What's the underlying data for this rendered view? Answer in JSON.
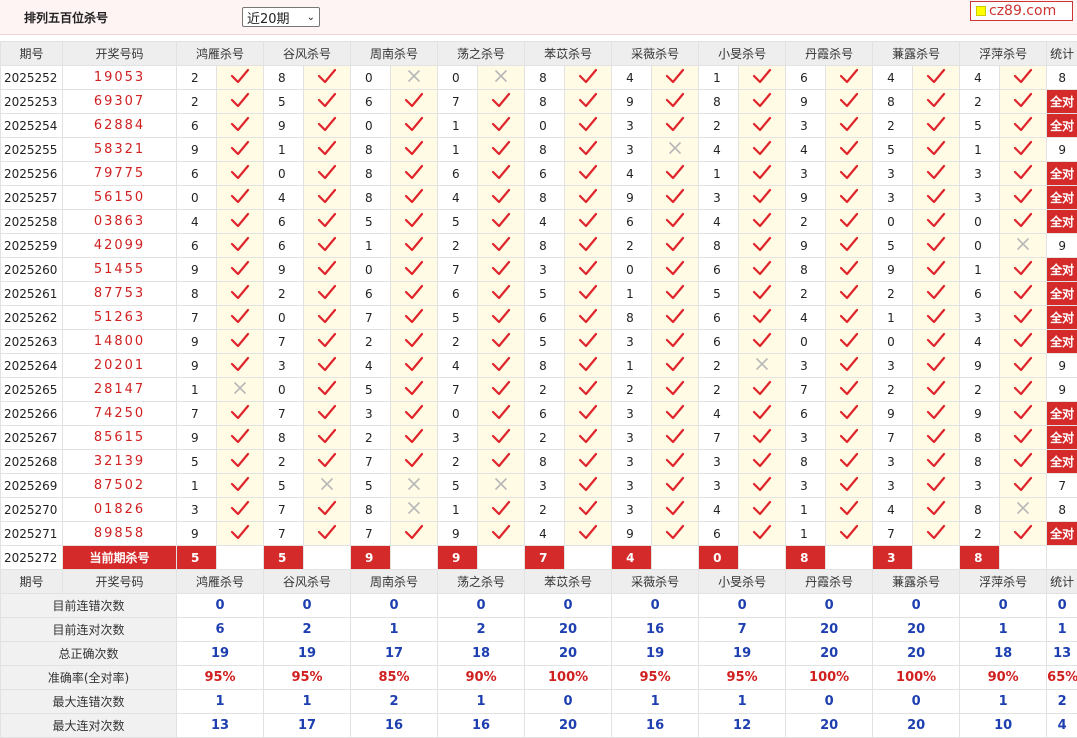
{
  "header": {
    "title": "排列五百位杀号",
    "select_value": "近20期",
    "logo_text": "cz89.com"
  },
  "columns": {
    "issue": "期号",
    "draw": "开奖号码",
    "experts": [
      "鸿雁杀号",
      "谷风杀号",
      "周南杀号",
      "荡之杀号",
      "苯苡杀号",
      "采薇杀号",
      "小旻杀号",
      "丹霞杀号",
      "蒹露杀号",
      "浮萍杀号"
    ],
    "stat": "统计"
  },
  "rows": [
    {
      "issue": "2025252",
      "draw": "19053",
      "kills": [
        [
          "2",
          "ok"
        ],
        [
          "8",
          "ok"
        ],
        [
          "0",
          "x"
        ],
        [
          "0",
          "x"
        ],
        [
          "8",
          "ok"
        ],
        [
          "4",
          "ok"
        ],
        [
          "1",
          "ok"
        ],
        [
          "6",
          "ok"
        ],
        [
          "4",
          "ok"
        ],
        [
          "4",
          "ok"
        ]
      ],
      "stat": "8"
    },
    {
      "issue": "2025253",
      "draw": "69307",
      "kills": [
        [
          "2",
          "ok"
        ],
        [
          "5",
          "ok"
        ],
        [
          "6",
          "ok"
        ],
        [
          "7",
          "ok"
        ],
        [
          "8",
          "ok"
        ],
        [
          "9",
          "ok"
        ],
        [
          "8",
          "ok"
        ],
        [
          "9",
          "ok"
        ],
        [
          "8",
          "ok"
        ],
        [
          "2",
          "ok"
        ]
      ],
      "stat": "全对"
    },
    {
      "issue": "2025254",
      "draw": "62884",
      "kills": [
        [
          "6",
          "ok"
        ],
        [
          "9",
          "ok"
        ],
        [
          "0",
          "ok"
        ],
        [
          "1",
          "ok"
        ],
        [
          "0",
          "ok"
        ],
        [
          "3",
          "ok"
        ],
        [
          "2",
          "ok"
        ],
        [
          "3",
          "ok"
        ],
        [
          "2",
          "ok"
        ],
        [
          "5",
          "ok"
        ]
      ],
      "stat": "全对"
    },
    {
      "issue": "2025255",
      "draw": "58321",
      "kills": [
        [
          "9",
          "ok"
        ],
        [
          "1",
          "ok"
        ],
        [
          "8",
          "ok"
        ],
        [
          "1",
          "ok"
        ],
        [
          "8",
          "ok"
        ],
        [
          "3",
          "x"
        ],
        [
          "4",
          "ok"
        ],
        [
          "4",
          "ok"
        ],
        [
          "5",
          "ok"
        ],
        [
          "1",
          "ok"
        ]
      ],
      "stat": "9"
    },
    {
      "issue": "2025256",
      "draw": "79775",
      "kills": [
        [
          "6",
          "ok"
        ],
        [
          "0",
          "ok"
        ],
        [
          "8",
          "ok"
        ],
        [
          "6",
          "ok"
        ],
        [
          "6",
          "ok"
        ],
        [
          "4",
          "ok"
        ],
        [
          "1",
          "ok"
        ],
        [
          "3",
          "ok"
        ],
        [
          "3",
          "ok"
        ],
        [
          "3",
          "ok"
        ]
      ],
      "stat": "全对"
    },
    {
      "issue": "2025257",
      "draw": "56150",
      "kills": [
        [
          "0",
          "ok"
        ],
        [
          "4",
          "ok"
        ],
        [
          "8",
          "ok"
        ],
        [
          "4",
          "ok"
        ],
        [
          "8",
          "ok"
        ],
        [
          "9",
          "ok"
        ],
        [
          "3",
          "ok"
        ],
        [
          "9",
          "ok"
        ],
        [
          "3",
          "ok"
        ],
        [
          "3",
          "ok"
        ]
      ],
      "stat": "全对"
    },
    {
      "issue": "2025258",
      "draw": "03863",
      "kills": [
        [
          "4",
          "ok"
        ],
        [
          "6",
          "ok"
        ],
        [
          "5",
          "ok"
        ],
        [
          "5",
          "ok"
        ],
        [
          "4",
          "ok"
        ],
        [
          "6",
          "ok"
        ],
        [
          "4",
          "ok"
        ],
        [
          "2",
          "ok"
        ],
        [
          "0",
          "ok"
        ],
        [
          "0",
          "ok"
        ]
      ],
      "stat": "全对"
    },
    {
      "issue": "2025259",
      "draw": "42099",
      "kills": [
        [
          "6",
          "ok"
        ],
        [
          "6",
          "ok"
        ],
        [
          "1",
          "ok"
        ],
        [
          "2",
          "ok"
        ],
        [
          "8",
          "ok"
        ],
        [
          "2",
          "ok"
        ],
        [
          "8",
          "ok"
        ],
        [
          "9",
          "ok"
        ],
        [
          "5",
          "ok"
        ],
        [
          "0",
          "x"
        ]
      ],
      "stat": "9"
    },
    {
      "issue": "2025260",
      "draw": "51455",
      "kills": [
        [
          "9",
          "ok"
        ],
        [
          "9",
          "ok"
        ],
        [
          "0",
          "ok"
        ],
        [
          "7",
          "ok"
        ],
        [
          "3",
          "ok"
        ],
        [
          "0",
          "ok"
        ],
        [
          "6",
          "ok"
        ],
        [
          "8",
          "ok"
        ],
        [
          "9",
          "ok"
        ],
        [
          "1",
          "ok"
        ]
      ],
      "stat": "全对"
    },
    {
      "issue": "2025261",
      "draw": "87753",
      "kills": [
        [
          "8",
          "ok"
        ],
        [
          "2",
          "ok"
        ],
        [
          "6",
          "ok"
        ],
        [
          "6",
          "ok"
        ],
        [
          "5",
          "ok"
        ],
        [
          "1",
          "ok"
        ],
        [
          "5",
          "ok"
        ],
        [
          "2",
          "ok"
        ],
        [
          "2",
          "ok"
        ],
        [
          "6",
          "ok"
        ]
      ],
      "stat": "全对"
    },
    {
      "issue": "2025262",
      "draw": "51263",
      "kills": [
        [
          "7",
          "ok"
        ],
        [
          "0",
          "ok"
        ],
        [
          "7",
          "ok"
        ],
        [
          "5",
          "ok"
        ],
        [
          "6",
          "ok"
        ],
        [
          "8",
          "ok"
        ],
        [
          "6",
          "ok"
        ],
        [
          "4",
          "ok"
        ],
        [
          "1",
          "ok"
        ],
        [
          "3",
          "ok"
        ]
      ],
      "stat": "全对"
    },
    {
      "issue": "2025263",
      "draw": "14800",
      "kills": [
        [
          "9",
          "ok"
        ],
        [
          "7",
          "ok"
        ],
        [
          "2",
          "ok"
        ],
        [
          "2",
          "ok"
        ],
        [
          "5",
          "ok"
        ],
        [
          "3",
          "ok"
        ],
        [
          "6",
          "ok"
        ],
        [
          "0",
          "ok"
        ],
        [
          "0",
          "ok"
        ],
        [
          "4",
          "ok"
        ]
      ],
      "stat": "全对"
    },
    {
      "issue": "2025264",
      "draw": "20201",
      "kills": [
        [
          "9",
          "ok"
        ],
        [
          "3",
          "ok"
        ],
        [
          "4",
          "ok"
        ],
        [
          "4",
          "ok"
        ],
        [
          "8",
          "ok"
        ],
        [
          "1",
          "ok"
        ],
        [
          "2",
          "x"
        ],
        [
          "3",
          "ok"
        ],
        [
          "3",
          "ok"
        ],
        [
          "9",
          "ok"
        ]
      ],
      "stat": "9"
    },
    {
      "issue": "2025265",
      "draw": "28147",
      "kills": [
        [
          "1",
          "x"
        ],
        [
          "0",
          "ok"
        ],
        [
          "5",
          "ok"
        ],
        [
          "7",
          "ok"
        ],
        [
          "2",
          "ok"
        ],
        [
          "2",
          "ok"
        ],
        [
          "2",
          "ok"
        ],
        [
          "7",
          "ok"
        ],
        [
          "2",
          "ok"
        ],
        [
          "2",
          "ok"
        ]
      ],
      "stat": "9"
    },
    {
      "issue": "2025266",
      "draw": "74250",
      "kills": [
        [
          "7",
          "ok"
        ],
        [
          "7",
          "ok"
        ],
        [
          "3",
          "ok"
        ],
        [
          "0",
          "ok"
        ],
        [
          "6",
          "ok"
        ],
        [
          "3",
          "ok"
        ],
        [
          "4",
          "ok"
        ],
        [
          "6",
          "ok"
        ],
        [
          "9",
          "ok"
        ],
        [
          "9",
          "ok"
        ]
      ],
      "stat": "全对"
    },
    {
      "issue": "2025267",
      "draw": "85615",
      "kills": [
        [
          "9",
          "ok"
        ],
        [
          "8",
          "ok"
        ],
        [
          "2",
          "ok"
        ],
        [
          "3",
          "ok"
        ],
        [
          "2",
          "ok"
        ],
        [
          "3",
          "ok"
        ],
        [
          "7",
          "ok"
        ],
        [
          "3",
          "ok"
        ],
        [
          "7",
          "ok"
        ],
        [
          "8",
          "ok"
        ]
      ],
      "stat": "全对"
    },
    {
      "issue": "2025268",
      "draw": "32139",
      "kills": [
        [
          "5",
          "ok"
        ],
        [
          "2",
          "ok"
        ],
        [
          "7",
          "ok"
        ],
        [
          "2",
          "ok"
        ],
        [
          "8",
          "ok"
        ],
        [
          "3",
          "ok"
        ],
        [
          "3",
          "ok"
        ],
        [
          "8",
          "ok"
        ],
        [
          "3",
          "ok"
        ],
        [
          "8",
          "ok"
        ]
      ],
      "stat": "全对"
    },
    {
      "issue": "2025269",
      "draw": "87502",
      "kills": [
        [
          "1",
          "ok"
        ],
        [
          "5",
          "x"
        ],
        [
          "5",
          "x"
        ],
        [
          "5",
          "x"
        ],
        [
          "3",
          "ok"
        ],
        [
          "3",
          "ok"
        ],
        [
          "3",
          "ok"
        ],
        [
          "3",
          "ok"
        ],
        [
          "3",
          "ok"
        ],
        [
          "3",
          "ok"
        ]
      ],
      "stat": "7"
    },
    {
      "issue": "2025270",
      "draw": "01826",
      "kills": [
        [
          "3",
          "ok"
        ],
        [
          "7",
          "ok"
        ],
        [
          "8",
          "x"
        ],
        [
          "1",
          "ok"
        ],
        [
          "2",
          "ok"
        ],
        [
          "3",
          "ok"
        ],
        [
          "4",
          "ok"
        ],
        [
          "1",
          "ok"
        ],
        [
          "4",
          "ok"
        ],
        [
          "8",
          "x"
        ]
      ],
      "stat": "8"
    },
    {
      "issue": "2025271",
      "draw": "89858",
      "kills": [
        [
          "9",
          "ok"
        ],
        [
          "7",
          "ok"
        ],
        [
          "7",
          "ok"
        ],
        [
          "9",
          "ok"
        ],
        [
          "4",
          "ok"
        ],
        [
          "9",
          "ok"
        ],
        [
          "6",
          "ok"
        ],
        [
          "1",
          "ok"
        ],
        [
          "7",
          "ok"
        ],
        [
          "2",
          "ok"
        ]
      ],
      "stat": "全对"
    }
  ],
  "current": {
    "issue": "2025272",
    "label": "当前期杀号",
    "kills": [
      "5",
      "5",
      "9",
      "9",
      "7",
      "4",
      "0",
      "8",
      "3",
      "8"
    ]
  },
  "summary": [
    {
      "label": "目前连错次数",
      "color": "blue",
      "values": [
        "0",
        "0",
        "0",
        "0",
        "0",
        "0",
        "0",
        "0",
        "0",
        "0"
      ],
      "stat": "0"
    },
    {
      "label": "目前连对次数",
      "color": "blue",
      "values": [
        "6",
        "2",
        "1",
        "2",
        "20",
        "16",
        "7",
        "20",
        "20",
        "1"
      ],
      "stat": "1"
    },
    {
      "label": "总正确次数",
      "color": "blue",
      "values": [
        "19",
        "19",
        "17",
        "18",
        "20",
        "19",
        "19",
        "20",
        "20",
        "18"
      ],
      "stat": "13"
    },
    {
      "label": "准确率(全对率)",
      "color": "red",
      "values": [
        "95%",
        "95%",
        "85%",
        "90%",
        "100%",
        "95%",
        "95%",
        "100%",
        "100%",
        "90%"
      ],
      "stat": "65%"
    },
    {
      "label": "最大连错次数",
      "color": "blue",
      "values": [
        "1",
        "1",
        "2",
        "1",
        "0",
        "1",
        "1",
        "0",
        "0",
        "1"
      ],
      "stat": "2"
    },
    {
      "label": "最大连对次数",
      "color": "blue",
      "values": [
        "13",
        "17",
        "16",
        "16",
        "20",
        "16",
        "12",
        "20",
        "20",
        "10"
      ],
      "stat": "4"
    }
  ],
  "colors": {
    "accent_red": "#d42a2a",
    "check_red": "#e0242c",
    "cross_gray": "#b8b8b8",
    "stat_blue": "#1e3fb0"
  }
}
